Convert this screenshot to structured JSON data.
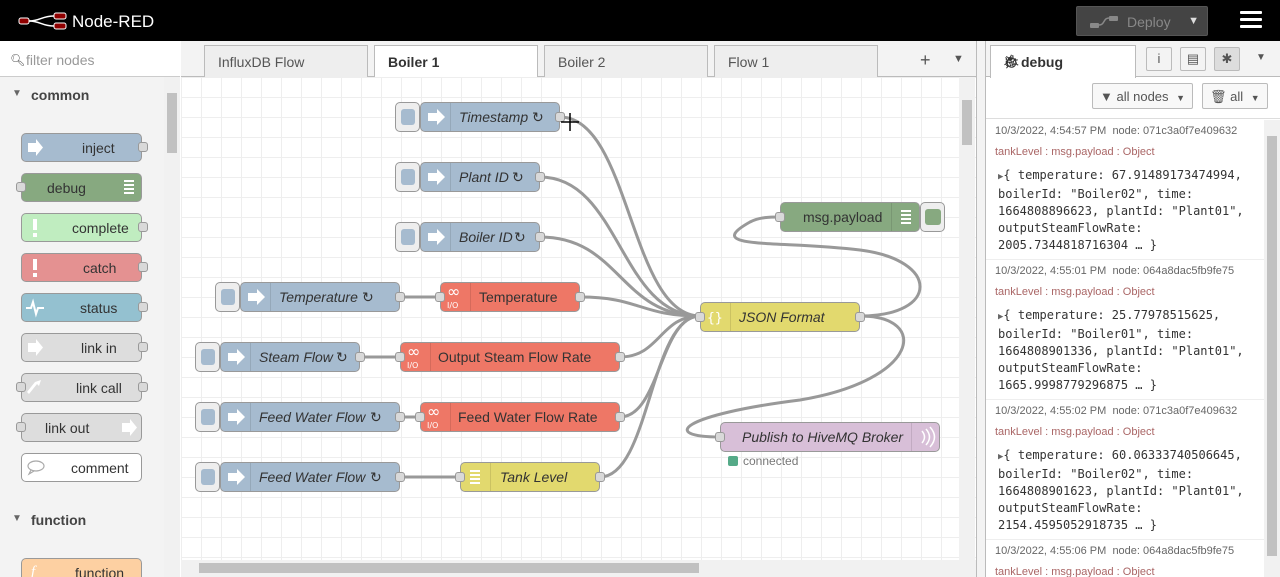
{
  "app": {
    "title": "Node-RED",
    "deploy_label": "Deploy"
  },
  "palette": {
    "filter_placeholder": "filter nodes",
    "categories": [
      {
        "label": "common",
        "nodes": [
          "inject",
          "debug",
          "complete",
          "catch",
          "status",
          "link in",
          "link call",
          "link out",
          "comment"
        ]
      },
      {
        "label": "function",
        "nodes": [
          "function"
        ]
      }
    ]
  },
  "tabs": [
    {
      "label": "InfluxDB Flow",
      "active": false
    },
    {
      "label": "Boiler 1",
      "active": true
    },
    {
      "label": "Boiler 2",
      "active": false
    },
    {
      "label": "Flow 1",
      "active": false
    }
  ],
  "flow": {
    "nodes": {
      "timestamp": "Timestamp",
      "plant_id": "Plant ID",
      "boiler_id": "Boiler ID",
      "temperature_inject": "Temperature",
      "temperature_fn": "Temperature",
      "steam_flow": "Steam Flow",
      "output_steam_flow_rate": "Output Steam Flow Rate",
      "feed_water_flow_1": "Feed Water Flow",
      "feed_water_flow_rate": "Feed Water Flow Rate",
      "feed_water_flow_2": "Feed Water Flow",
      "tank_level": "Tank Level",
      "json_format": "JSON Format",
      "msg_payload": "msg.payload",
      "publish": "Publish to HiveMQ Broker",
      "publish_status": "connected"
    }
  },
  "sidebar": {
    "active_tab": "debug",
    "filter_nodes_label": "all nodes",
    "filter_all_label": "all",
    "messages": [
      {
        "time": "10/3/2022, 4:54:57 PM",
        "node": "node: 071c3a0f7e409632",
        "topic": "tankLevel : msg.payload : Object",
        "lines": [
          "{ temperature: 67.91489173474994,",
          "boilerId: \"Boiler02\", time:",
          "1664808896623, plantId: \"Plant01\",",
          "outputSteamFlowRate:",
          "2005.7344818716304 … }"
        ]
      },
      {
        "time": "10/3/2022, 4:55:01 PM",
        "node": "node: 064a8dac5fb9fe75",
        "topic": "tankLevel : msg.payload : Object",
        "lines": [
          "{ temperature: 25.77978515625,",
          "boilerId: \"Boiler01\", time:",
          "1664808901336, plantId: \"Plant01\",",
          "outputSteamFlowRate:",
          "1665.9998779296875 … }"
        ]
      },
      {
        "time": "10/3/2022, 4:55:02 PM",
        "node": "node: 071c3a0f7e409632",
        "topic": "tankLevel : msg.payload : Object",
        "lines": [
          "{ temperature: 60.06333740506645,",
          "boilerId: \"Boiler02\", time:",
          "1664808901623, plantId: \"Plant01\",",
          "outputSteamFlowRate:",
          "2154.4595052918735 … }"
        ]
      },
      {
        "time": "10/3/2022, 4:55:06 PM",
        "node": "node: 064a8dac5fb9fe75",
        "topic": "tankLevel : msg.payload : Object",
        "lines": []
      }
    ]
  },
  "colors": {
    "inject": "#a6bbcf",
    "debug": "#87a980",
    "complete": "#c0edc0",
    "catch": "#e49191",
    "status": "#94c1d0",
    "link": "#dddddd",
    "function": "#fdd0a2",
    "change": "#e2d96e",
    "template": "#e7e7ae",
    "mqtt": "#d8bfd8",
    "header": "#000000"
  }
}
